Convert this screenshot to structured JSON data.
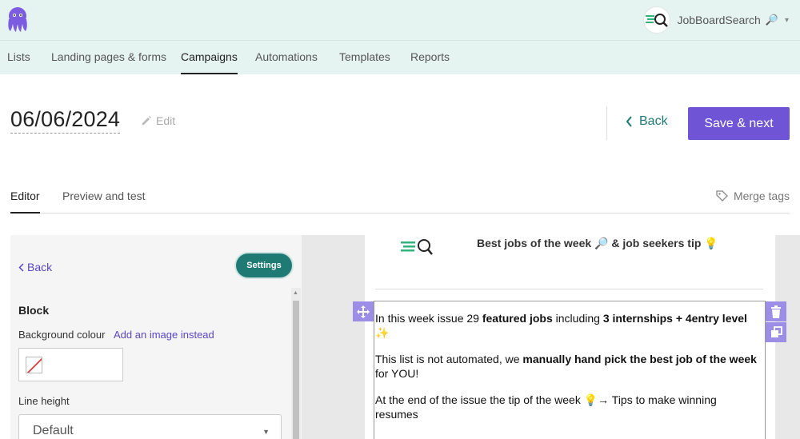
{
  "account": {
    "name": "JobBoardSearch",
    "emoji": "🔎",
    "caret": "▾"
  },
  "nav": {
    "items": [
      "Lists",
      "Landing pages & forms",
      "Campaigns",
      "Automations",
      "Templates",
      "Reports"
    ],
    "active": "Campaigns"
  },
  "header": {
    "title": "06/06/2024",
    "edit_label": "Edit",
    "back_label": "Back",
    "save_label": "Save & next"
  },
  "subtabs": {
    "editor": "Editor",
    "preview": "Preview and test",
    "merge_tags": "Merge tags"
  },
  "panel": {
    "back_label": "Back",
    "settings_label": "Settings",
    "block_heading": "Block",
    "bg_label": "Background colour",
    "bg_link": "Add an image instead",
    "line_height_label": "Line height",
    "line_height_value": "Default"
  },
  "email": {
    "title": "Best jobs of the week 🔎 & job seekers tip 💡",
    "p1": {
      "a": "In this week issue 29 ",
      "b": "featured jobs",
      "c": " including ",
      "d": "3 internships + 4entry level",
      "e": " ✨"
    },
    "p2": {
      "a": "This list is not automated, we ",
      "b": "manually hand pick the best job of the week",
      "c": " for YOU!"
    },
    "p3": "At the end of the issue the tip of the week 💡→ Tips to make winning resumes"
  },
  "colors": {
    "accent": "#7054d6",
    "teal": "#1f7a73",
    "header_bg": "#e6f4f1",
    "handle": "#9c8ee6"
  },
  "icons": [
    "octopus-logo",
    "search-icon",
    "pencil-icon",
    "chevron-left-icon",
    "tag-icon",
    "move-icon",
    "trash-icon",
    "copy-icon",
    "no-color-icon"
  ]
}
